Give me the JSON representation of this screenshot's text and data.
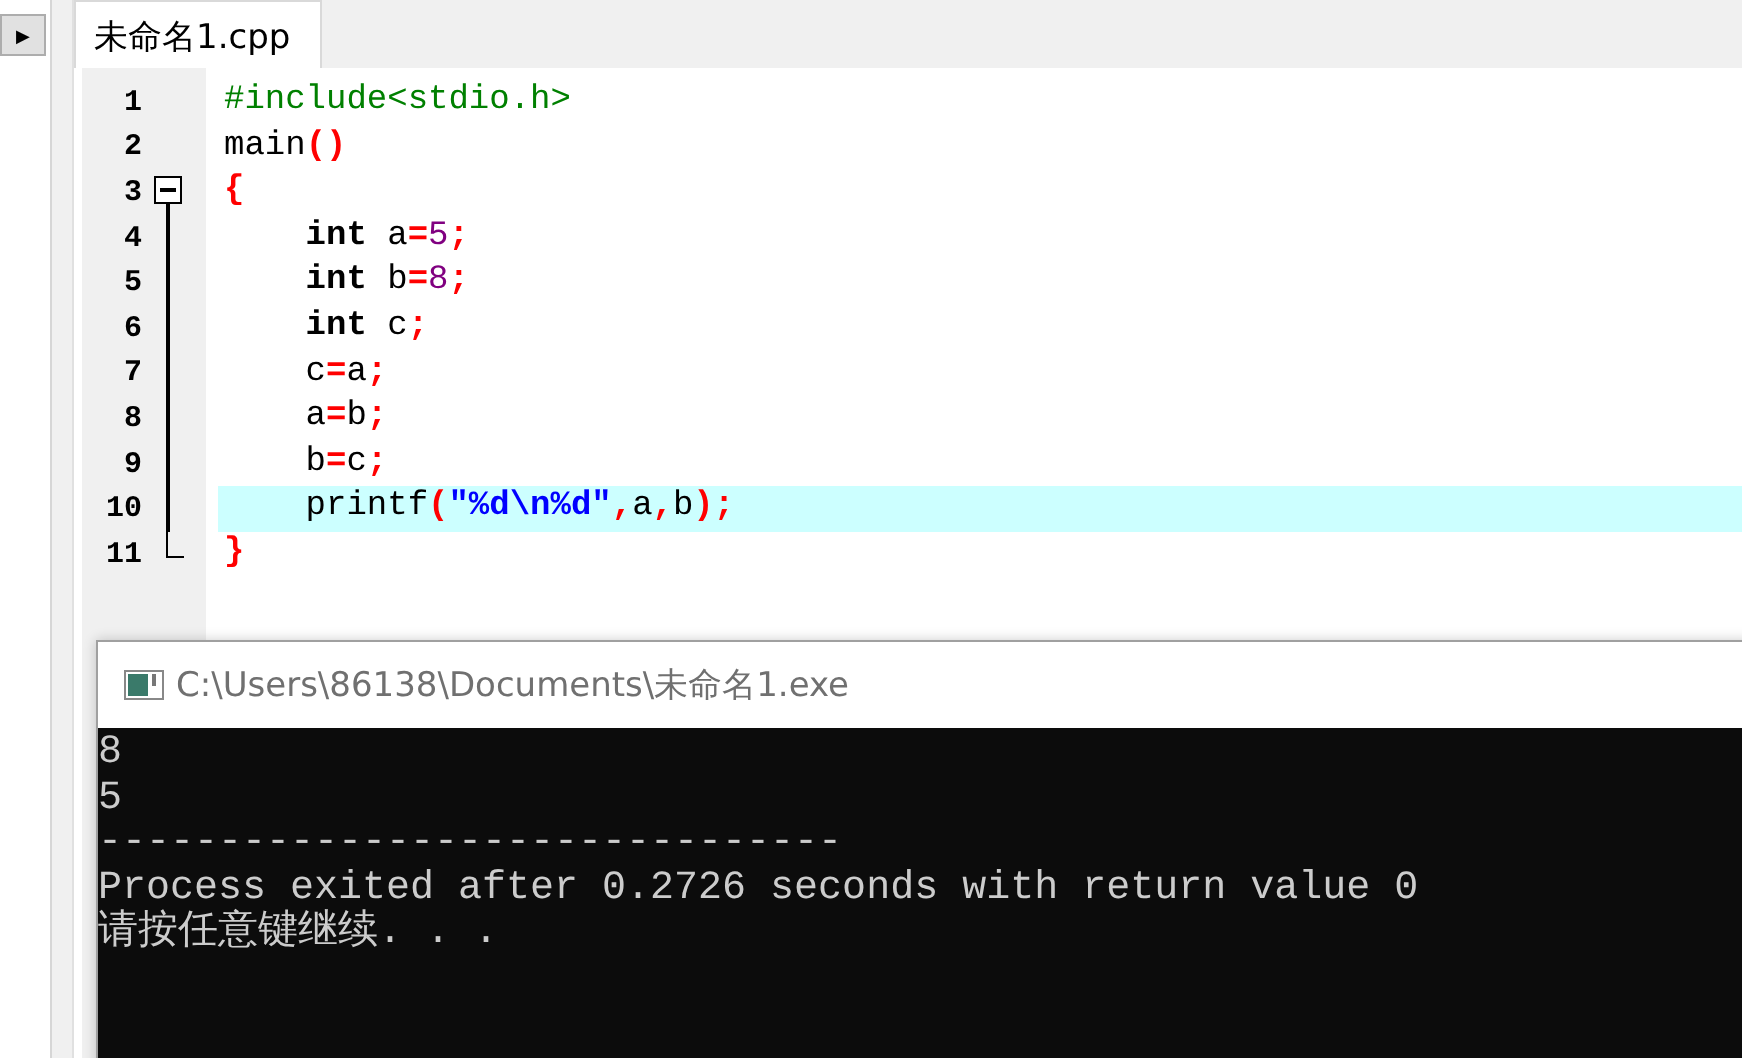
{
  "sidebar": {
    "toggle": "▶"
  },
  "editor": {
    "tab": {
      "label": "未命名1.cpp",
      "selected": true
    },
    "lines": [
      {
        "number": "1",
        "highlighted": false,
        "tokens": [
          {
            "kind": "preproc",
            "text": "#include<stdio.h>"
          }
        ]
      },
      {
        "number": "2",
        "highlighted": false,
        "tokens": [
          {
            "kind": "plain",
            "text": "main"
          },
          {
            "kind": "symbol",
            "text": "()"
          }
        ]
      },
      {
        "number": "3",
        "highlighted": false,
        "expanded": true,
        "tokens": [
          {
            "kind": "symbol",
            "text": "{"
          }
        ],
        "children": [
          {
            "number": "4",
            "highlighted": false,
            "tokens": [
              {
                "kind": "keyword",
                "text": "    int"
              },
              {
                "kind": "plain",
                "text": " a"
              },
              {
                "kind": "symbol",
                "text": "="
              },
              {
                "kind": "number",
                "text": "5"
              },
              {
                "kind": "symbol",
                "text": ";"
              }
            ]
          },
          {
            "number": "5",
            "highlighted": false,
            "tokens": [
              {
                "kind": "keyword",
                "text": "    int"
              },
              {
                "kind": "plain",
                "text": " b"
              },
              {
                "kind": "symbol",
                "text": "="
              },
              {
                "kind": "number",
                "text": "8"
              },
              {
                "kind": "symbol",
                "text": ";"
              }
            ]
          },
          {
            "number": "6",
            "highlighted": false,
            "tokens": [
              {
                "kind": "keyword",
                "text": "    int"
              },
              {
                "kind": "plain",
                "text": " c"
              },
              {
                "kind": "symbol",
                "text": ";"
              }
            ]
          },
          {
            "number": "7",
            "highlighted": false,
            "tokens": [
              {
                "kind": "plain",
                "text": "    c"
              },
              {
                "kind": "symbol",
                "text": "="
              },
              {
                "kind": "plain",
                "text": "a"
              },
              {
                "kind": "symbol",
                "text": ";"
              }
            ]
          },
          {
            "number": "8",
            "highlighted": false,
            "tokens": [
              {
                "kind": "plain",
                "text": "    a"
              },
              {
                "kind": "symbol",
                "text": "="
              },
              {
                "kind": "plain",
                "text": "b"
              },
              {
                "kind": "symbol",
                "text": ";"
              }
            ]
          },
          {
            "number": "9",
            "highlighted": false,
            "tokens": [
              {
                "kind": "plain",
                "text": "    b"
              },
              {
                "kind": "symbol",
                "text": "="
              },
              {
                "kind": "plain",
                "text": "c"
              },
              {
                "kind": "symbol",
                "text": ";"
              }
            ]
          },
          {
            "number": "10",
            "highlighted": true,
            "tokens": [
              {
                "kind": "plain",
                "text": "    printf"
              },
              {
                "kind": "symbol",
                "text": "("
              },
              {
                "kind": "string",
                "text": "\"%d\\n%d\""
              },
              {
                "kind": "symbol",
                "text": ","
              },
              {
                "kind": "plain",
                "text": "a"
              },
              {
                "kind": "symbol",
                "text": ","
              },
              {
                "kind": "plain",
                "text": "b"
              },
              {
                "kind": "symbol",
                "text": ");"
              }
            ]
          },
          {
            "number": "11",
            "highlighted": false,
            "tokens": [
              {
                "kind": "symbol",
                "text": "}"
              }
            ]
          }
        ]
      }
    ]
  },
  "console": {
    "title": "C:\\Users\\86138\\Documents\\未命名1.exe",
    "output": [
      "8",
      "5",
      "-------------------------------",
      "Process exited after 0.2726 seconds with return value 0",
      "请按任意键继续. . ."
    ]
  }
}
